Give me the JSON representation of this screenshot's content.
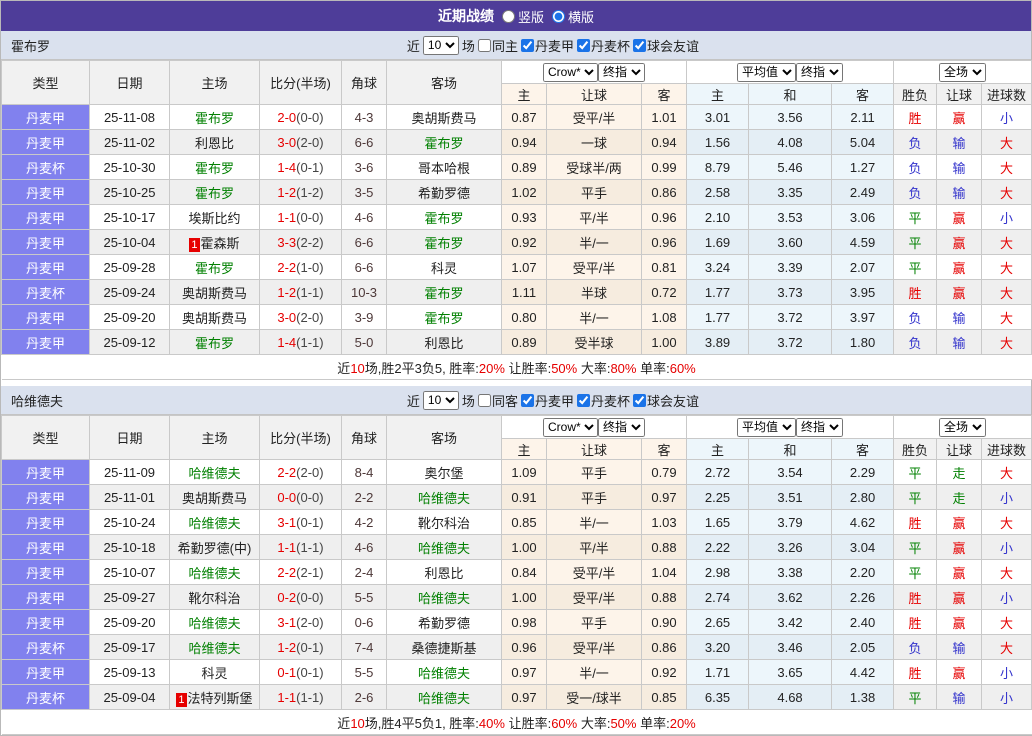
{
  "title_bar": {
    "title": "近期战绩",
    "options": [
      {
        "label": "竖版",
        "checked": false
      },
      {
        "label": "横版",
        "checked": true
      }
    ]
  },
  "colors": {
    "title_bar_bg": "#4e3d99",
    "type_cell_bg": "#8181ee",
    "team_focus": "#008000",
    "win": "#e60000",
    "loss": "#3333cc",
    "draw": "#008000"
  },
  "table_header": {
    "static_cols": [
      "类型",
      "日期",
      "主场",
      "比分(半场)",
      "角球",
      "客场"
    ],
    "groups": [
      {
        "selects": [
          "Crow*",
          "终指"
        ],
        "cols": [
          "主",
          "让球",
          "客"
        ],
        "tint": "g1"
      },
      {
        "selects": [
          "平均值",
          "终指"
        ],
        "cols": [
          "主",
          "和",
          "客"
        ],
        "tint": "g2"
      },
      {
        "selects": [
          "全场"
        ],
        "cols": [
          "胜负",
          "让球",
          "进球数"
        ],
        "tint": "g0"
      }
    ]
  },
  "teams": [
    {
      "name": "霍布罗",
      "filter": {
        "prefix": "近",
        "matches": "10",
        "suffix": "场",
        "same_label": "同主",
        "same_checked": false,
        "leagues": [
          {
            "label": "丹麦甲",
            "checked": true
          },
          {
            "label": "丹麦杯",
            "checked": true
          },
          {
            "label": "球会友谊",
            "checked": true
          }
        ]
      },
      "rows": [
        {
          "type": "丹麦甲",
          "date": "25-11-08",
          "home": "霍布罗",
          "home_focus": true,
          "home_badge": "",
          "score": "2-0",
          "half": "(0-0)",
          "corner": "4-3",
          "away": "奥胡斯费马",
          "away_focus": false,
          "odds": [
            "0.87",
            "受平/半",
            "1.01"
          ],
          "avg": [
            "3.01",
            "3.56",
            "2.11"
          ],
          "result": [
            [
              "胜",
              "red"
            ],
            [
              "赢",
              "red"
            ],
            [
              "小",
              "blue"
            ]
          ]
        },
        {
          "type": "丹麦甲",
          "date": "25-11-02",
          "home": "利恩比",
          "home_focus": false,
          "home_badge": "",
          "score": "3-0",
          "half": "(2-0)",
          "corner": "6-6",
          "away": "霍布罗",
          "away_focus": true,
          "odds": [
            "0.94",
            "一球",
            "0.94"
          ],
          "avg": [
            "1.56",
            "4.08",
            "5.04"
          ],
          "result": [
            [
              "负",
              "blue"
            ],
            [
              "输",
              "blue"
            ],
            [
              "大",
              "red"
            ]
          ]
        },
        {
          "type": "丹麦杯",
          "date": "25-10-30",
          "home": "霍布罗",
          "home_focus": true,
          "home_badge": "",
          "score": "1-4",
          "half": "(0-1)",
          "corner": "3-6",
          "away": "哥本哈根",
          "away_focus": false,
          "odds": [
            "0.89",
            "受球半/两",
            "0.99"
          ],
          "avg": [
            "8.79",
            "5.46",
            "1.27"
          ],
          "result": [
            [
              "负",
              "blue"
            ],
            [
              "输",
              "blue"
            ],
            [
              "大",
              "red"
            ]
          ]
        },
        {
          "type": "丹麦甲",
          "date": "25-10-25",
          "home": "霍布罗",
          "home_focus": true,
          "home_badge": "",
          "score": "1-2",
          "half": "(1-2)",
          "corner": "3-5",
          "away": "希勤罗德",
          "away_focus": false,
          "odds": [
            "1.02",
            "平手",
            "0.86"
          ],
          "avg": [
            "2.58",
            "3.35",
            "2.49"
          ],
          "result": [
            [
              "负",
              "blue"
            ],
            [
              "输",
              "blue"
            ],
            [
              "大",
              "red"
            ]
          ]
        },
        {
          "type": "丹麦甲",
          "date": "25-10-17",
          "home": "埃斯比约",
          "home_focus": false,
          "home_badge": "",
          "score": "1-1",
          "half": "(0-0)",
          "corner": "4-6",
          "away": "霍布罗",
          "away_focus": true,
          "odds": [
            "0.93",
            "平/半",
            "0.96"
          ],
          "avg": [
            "2.10",
            "3.53",
            "3.06"
          ],
          "result": [
            [
              "平",
              "green"
            ],
            [
              "赢",
              "red"
            ],
            [
              "小",
              "blue"
            ]
          ]
        },
        {
          "type": "丹麦甲",
          "date": "25-10-04",
          "home": "霍森斯",
          "home_focus": false,
          "home_badge": "1",
          "score": "3-3",
          "half": "(2-2)",
          "corner": "6-6",
          "away": "霍布罗",
          "away_focus": true,
          "odds": [
            "0.92",
            "半/一",
            "0.96"
          ],
          "avg": [
            "1.69",
            "3.60",
            "4.59"
          ],
          "result": [
            [
              "平",
              "green"
            ],
            [
              "赢",
              "red"
            ],
            [
              "大",
              "red"
            ]
          ]
        },
        {
          "type": "丹麦甲",
          "date": "25-09-28",
          "home": "霍布罗",
          "home_focus": true,
          "home_badge": "",
          "score": "2-2",
          "half": "(1-0)",
          "corner": "6-6",
          "away": "科灵",
          "away_focus": false,
          "odds": [
            "1.07",
            "受平/半",
            "0.81"
          ],
          "avg": [
            "3.24",
            "3.39",
            "2.07"
          ],
          "result": [
            [
              "平",
              "green"
            ],
            [
              "赢",
              "red"
            ],
            [
              "大",
              "red"
            ]
          ]
        },
        {
          "type": "丹麦杯",
          "date": "25-09-24",
          "home": "奥胡斯费马",
          "home_focus": false,
          "home_badge": "",
          "score": "1-2",
          "half": "(1-1)",
          "corner": "10-3",
          "away": "霍布罗",
          "away_focus": true,
          "odds": [
            "1.11",
            "半球",
            "0.72"
          ],
          "avg": [
            "1.77",
            "3.73",
            "3.95"
          ],
          "result": [
            [
              "胜",
              "red"
            ],
            [
              "赢",
              "red"
            ],
            [
              "大",
              "red"
            ]
          ]
        },
        {
          "type": "丹麦甲",
          "date": "25-09-20",
          "home": "奥胡斯费马",
          "home_focus": false,
          "home_badge": "",
          "score": "3-0",
          "half": "(2-0)",
          "corner": "3-9",
          "away": "霍布罗",
          "away_focus": true,
          "odds": [
            "0.80",
            "半/一",
            "1.08"
          ],
          "avg": [
            "1.77",
            "3.72",
            "3.97"
          ],
          "result": [
            [
              "负",
              "blue"
            ],
            [
              "输",
              "blue"
            ],
            [
              "大",
              "red"
            ]
          ]
        },
        {
          "type": "丹麦甲",
          "date": "25-09-12",
          "home": "霍布罗",
          "home_focus": true,
          "home_badge": "",
          "score": "1-4",
          "half": "(1-1)",
          "corner": "5-0",
          "away": "利恩比",
          "away_focus": false,
          "odds": [
            "0.89",
            "受半球",
            "1.00"
          ],
          "avg": [
            "3.89",
            "3.72",
            "1.80"
          ],
          "result": [
            [
              "负",
              "blue"
            ],
            [
              "输",
              "blue"
            ],
            [
              "大",
              "red"
            ]
          ]
        }
      ],
      "summary": [
        {
          "t": "近",
          "c": "k"
        },
        {
          "t": "10",
          "c": "r"
        },
        {
          "t": "场,胜2平3负5, 胜率:",
          "c": "k"
        },
        {
          "t": "20%",
          "c": "r"
        },
        {
          "t": " 让胜率:",
          "c": "k"
        },
        {
          "t": "50%",
          "c": "r"
        },
        {
          "t": " 大率:",
          "c": "k"
        },
        {
          "t": "80%",
          "c": "r"
        },
        {
          "t": " 单率:",
          "c": "k"
        },
        {
          "t": "60%",
          "c": "r"
        }
      ]
    },
    {
      "name": "哈维德夫",
      "filter": {
        "prefix": "近",
        "matches": "10",
        "suffix": "场",
        "same_label": "同客",
        "same_checked": false,
        "leagues": [
          {
            "label": "丹麦甲",
            "checked": true
          },
          {
            "label": "丹麦杯",
            "checked": true
          },
          {
            "label": "球会友谊",
            "checked": true
          }
        ]
      },
      "rows": [
        {
          "type": "丹麦甲",
          "date": "25-11-09",
          "home": "哈维德夫",
          "home_focus": true,
          "home_badge": "",
          "score": "2-2",
          "half": "(2-0)",
          "corner": "8-4",
          "away": "奥尔堡",
          "away_focus": false,
          "odds": [
            "1.09",
            "平手",
            "0.79"
          ],
          "avg": [
            "2.72",
            "3.54",
            "2.29"
          ],
          "result": [
            [
              "平",
              "green"
            ],
            [
              "走",
              "green"
            ],
            [
              "大",
              "red"
            ]
          ]
        },
        {
          "type": "丹麦甲",
          "date": "25-11-01",
          "home": "奥胡斯费马",
          "home_focus": false,
          "home_badge": "",
          "score": "0-0",
          "half": "(0-0)",
          "corner": "2-2",
          "away": "哈维德夫",
          "away_focus": true,
          "odds": [
            "0.91",
            "平手",
            "0.97"
          ],
          "avg": [
            "2.25",
            "3.51",
            "2.80"
          ],
          "result": [
            [
              "平",
              "green"
            ],
            [
              "走",
              "green"
            ],
            [
              "小",
              "blue"
            ]
          ]
        },
        {
          "type": "丹麦甲",
          "date": "25-10-24",
          "home": "哈维德夫",
          "home_focus": true,
          "home_badge": "",
          "score": "3-1",
          "half": "(0-1)",
          "corner": "4-2",
          "away": "靴尔科治",
          "away_focus": false,
          "odds": [
            "0.85",
            "半/一",
            "1.03"
          ],
          "avg": [
            "1.65",
            "3.79",
            "4.62"
          ],
          "result": [
            [
              "胜",
              "red"
            ],
            [
              "赢",
              "red"
            ],
            [
              "大",
              "red"
            ]
          ]
        },
        {
          "type": "丹麦甲",
          "date": "25-10-18",
          "home": "希勤罗德(中)",
          "home_focus": false,
          "home_badge": "",
          "score": "1-1",
          "half": "(1-1)",
          "corner": "4-6",
          "away": "哈维德夫",
          "away_focus": true,
          "odds": [
            "1.00",
            "平/半",
            "0.88"
          ],
          "avg": [
            "2.22",
            "3.26",
            "3.04"
          ],
          "result": [
            [
              "平",
              "green"
            ],
            [
              "赢",
              "red"
            ],
            [
              "小",
              "blue"
            ]
          ]
        },
        {
          "type": "丹麦甲",
          "date": "25-10-07",
          "home": "哈维德夫",
          "home_focus": true,
          "home_badge": "",
          "score": "2-2",
          "half": "(2-1)",
          "corner": "2-4",
          "away": "利恩比",
          "away_focus": false,
          "odds": [
            "0.84",
            "受平/半",
            "1.04"
          ],
          "avg": [
            "2.98",
            "3.38",
            "2.20"
          ],
          "result": [
            [
              "平",
              "green"
            ],
            [
              "赢",
              "red"
            ],
            [
              "大",
              "red"
            ]
          ]
        },
        {
          "type": "丹麦甲",
          "date": "25-09-27",
          "home": "靴尔科治",
          "home_focus": false,
          "home_badge": "",
          "score": "0-2",
          "half": "(0-0)",
          "corner": "5-5",
          "away": "哈维德夫",
          "away_focus": true,
          "odds": [
            "1.00",
            "受平/半",
            "0.88"
          ],
          "avg": [
            "2.74",
            "3.62",
            "2.26"
          ],
          "result": [
            [
              "胜",
              "red"
            ],
            [
              "赢",
              "red"
            ],
            [
              "小",
              "blue"
            ]
          ]
        },
        {
          "type": "丹麦甲",
          "date": "25-09-20",
          "home": "哈维德夫",
          "home_focus": true,
          "home_badge": "",
          "score": "3-1",
          "half": "(2-0)",
          "corner": "0-6",
          "away": "希勤罗德",
          "away_focus": false,
          "odds": [
            "0.98",
            "平手",
            "0.90"
          ],
          "avg": [
            "2.65",
            "3.42",
            "2.40"
          ],
          "result": [
            [
              "胜",
              "red"
            ],
            [
              "赢",
              "red"
            ],
            [
              "大",
              "red"
            ]
          ]
        },
        {
          "type": "丹麦杯",
          "date": "25-09-17",
          "home": "哈维德夫",
          "home_focus": true,
          "home_badge": "",
          "score": "1-2",
          "half": "(0-1)",
          "corner": "7-4",
          "away": "桑德捷斯基",
          "away_focus": false,
          "odds": [
            "0.96",
            "受平/半",
            "0.86"
          ],
          "avg": [
            "3.20",
            "3.46",
            "2.05"
          ],
          "result": [
            [
              "负",
              "blue"
            ],
            [
              "输",
              "blue"
            ],
            [
              "大",
              "red"
            ]
          ]
        },
        {
          "type": "丹麦甲",
          "date": "25-09-13",
          "home": "科灵",
          "home_focus": false,
          "home_badge": "",
          "score": "0-1",
          "half": "(0-1)",
          "corner": "5-5",
          "away": "哈维德夫",
          "away_focus": true,
          "odds": [
            "0.97",
            "半/一",
            "0.92"
          ],
          "avg": [
            "1.71",
            "3.65",
            "4.42"
          ],
          "result": [
            [
              "胜",
              "red"
            ],
            [
              "赢",
              "red"
            ],
            [
              "小",
              "blue"
            ]
          ]
        },
        {
          "type": "丹麦杯",
          "date": "25-09-04",
          "home": "法特列斯堡",
          "home_focus": false,
          "home_badge": "1",
          "score": "1-1",
          "half": "(1-1)",
          "corner": "2-6",
          "away": "哈维德夫",
          "away_focus": true,
          "odds": [
            "0.97",
            "受一/球半",
            "0.85"
          ],
          "avg": [
            "6.35",
            "4.68",
            "1.38"
          ],
          "result": [
            [
              "平",
              "green"
            ],
            [
              "输",
              "blue"
            ],
            [
              "小",
              "blue"
            ]
          ]
        }
      ],
      "summary": [
        {
          "t": "近",
          "c": "k"
        },
        {
          "t": "10",
          "c": "r"
        },
        {
          "t": "场,胜4平5负1, 胜率:",
          "c": "k"
        },
        {
          "t": "40%",
          "c": "r"
        },
        {
          "t": " 让胜率:",
          "c": "k"
        },
        {
          "t": "60%",
          "c": "r"
        },
        {
          "t": " 大率:",
          "c": "k"
        },
        {
          "t": "50%",
          "c": "r"
        },
        {
          "t": " 单率:",
          "c": "k"
        },
        {
          "t": "20%",
          "c": "r"
        }
      ]
    }
  ]
}
